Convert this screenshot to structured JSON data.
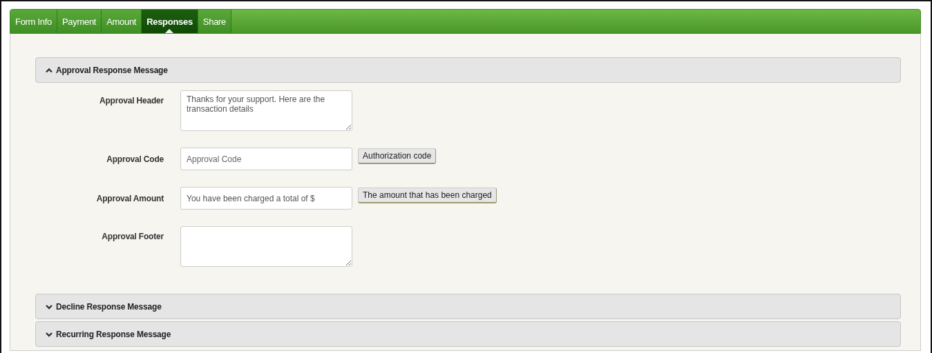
{
  "tabs": [
    {
      "label": "Form Info",
      "selected": false
    },
    {
      "label": "Payment",
      "selected": false
    },
    {
      "label": "Amount",
      "selected": false
    },
    {
      "label": "Responses",
      "selected": true
    },
    {
      "label": "Share",
      "selected": false
    }
  ],
  "sections": [
    {
      "title": "Approval Response Message",
      "expanded": true,
      "fields": [
        {
          "label": "Approval Header",
          "kind": "textarea",
          "value": "Thanks for your support. Here are the transaction details"
        },
        {
          "label": "Approval Code",
          "kind": "input",
          "placeholder": "Approval Code",
          "hint": "Authorization code"
        },
        {
          "label": "Approval Amount",
          "kind": "input",
          "value": "You have been charged a total of $",
          "hint": "The amount that has been charged"
        },
        {
          "label": "Approval Footer",
          "kind": "textarea"
        }
      ]
    },
    {
      "title": "Decline Response Message",
      "expanded": false
    },
    {
      "title": "Recurring Response Message",
      "expanded": false
    }
  ]
}
